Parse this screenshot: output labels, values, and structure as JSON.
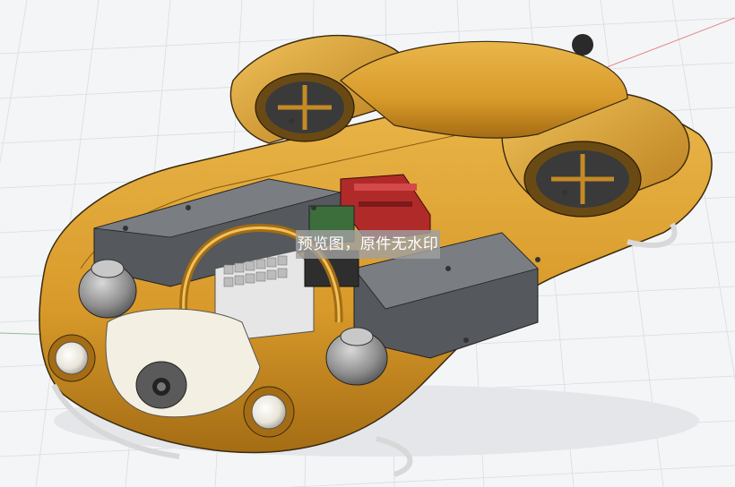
{
  "viewport": {
    "watermark_text": "预览图，原件无水印",
    "model_icon": "hovercraft-robot-cad-model",
    "colors": {
      "body": "#d89a2a",
      "body_dark": "#a46c14",
      "body_light": "#eab64a",
      "grid_line": "#d6d9de",
      "background": "#f4f5f7",
      "component_gray": "#6f7072",
      "battery_dark": "#4f5052",
      "red_board": "#b02a2a",
      "axis_x": "#e03a3a",
      "axis_y": "#3a7a3a",
      "axis_z": "#2a2ad0"
    }
  }
}
